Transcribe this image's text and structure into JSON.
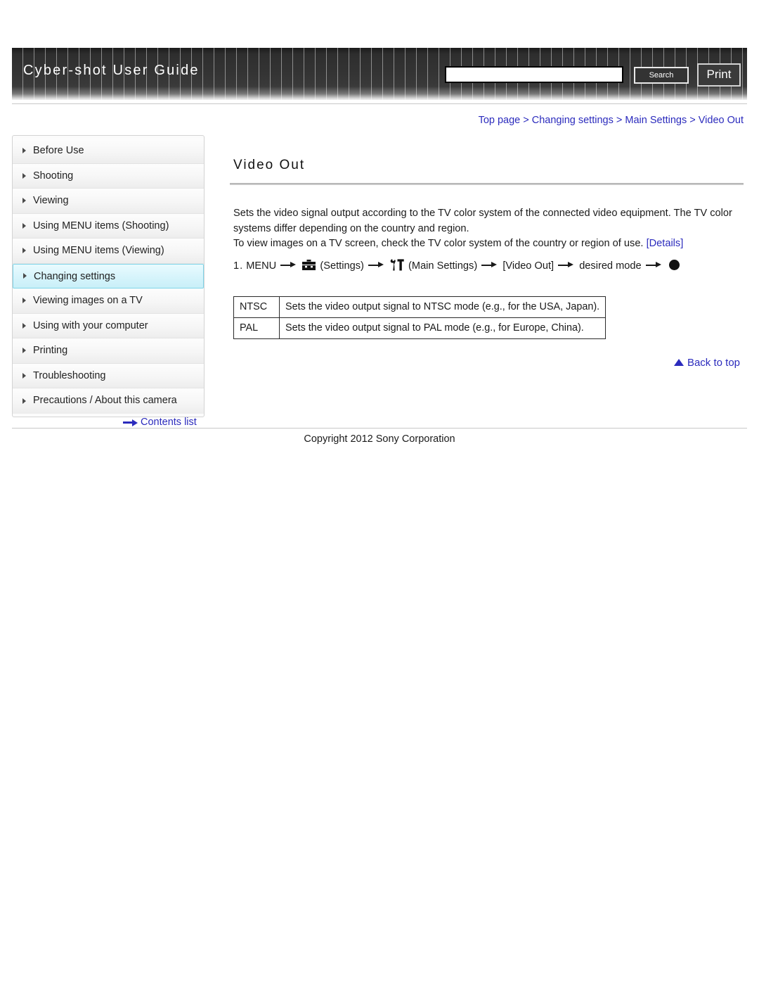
{
  "header": {
    "title": "Cyber-shot User Guide",
    "search_value": "",
    "search_placeholder": "",
    "search_label": "Search",
    "print_label": "Print"
  },
  "breadcrumb": {
    "items": [
      "Top page",
      "Changing settings",
      "Main Settings",
      "Video Out"
    ],
    "separator": ">",
    "full": "Top page > Changing settings > Main Settings > Video Out"
  },
  "sidebar": {
    "items": [
      {
        "label": "Before Use",
        "active": false
      },
      {
        "label": "Shooting",
        "active": false
      },
      {
        "label": "Viewing",
        "active": false
      },
      {
        "label": "Using MENU items (Shooting)",
        "active": false
      },
      {
        "label": "Using MENU items (Viewing)",
        "active": false
      },
      {
        "label": "Changing settings",
        "active": true
      },
      {
        "label": "Viewing images on a TV",
        "active": false
      },
      {
        "label": "Using with your computer",
        "active": false
      },
      {
        "label": "Printing",
        "active": false
      },
      {
        "label": "Troubleshooting",
        "active": false
      },
      {
        "label": "Precautions / About this camera",
        "active": false
      }
    ],
    "contents_link": "Contents list"
  },
  "main": {
    "title": "Video Out",
    "paragraph1": "Sets the video signal output according to the TV color system of the connected video equipment. The TV color systems differ depending on the country and region.",
    "paragraph2": "To view images on a TV screen, check the TV color system of the country or region of use.",
    "details_link": "[Details]",
    "step": {
      "number": "1.",
      "menu": "MENU",
      "settings_label": "(Settings)",
      "main_settings_label": "(Main Settings)",
      "item_label": "[Video Out]",
      "mode_label": "desired mode"
    },
    "table": {
      "rows": [
        {
          "key": "NTSC",
          "description": "Sets the video output signal to NTSC mode (e.g., for the USA, Japan)."
        },
        {
          "key": "PAL",
          "description": "Sets the video output signal to PAL mode (e.g., for Europe, China)."
        }
      ]
    },
    "back_to_top": "Back to top"
  },
  "footer": {
    "copyright": "Copyright 2012 Sony Corporation"
  },
  "colors": {
    "link": "#2b2bbd",
    "header_bg": "#333333",
    "active_nav": "#d6f4fb"
  }
}
